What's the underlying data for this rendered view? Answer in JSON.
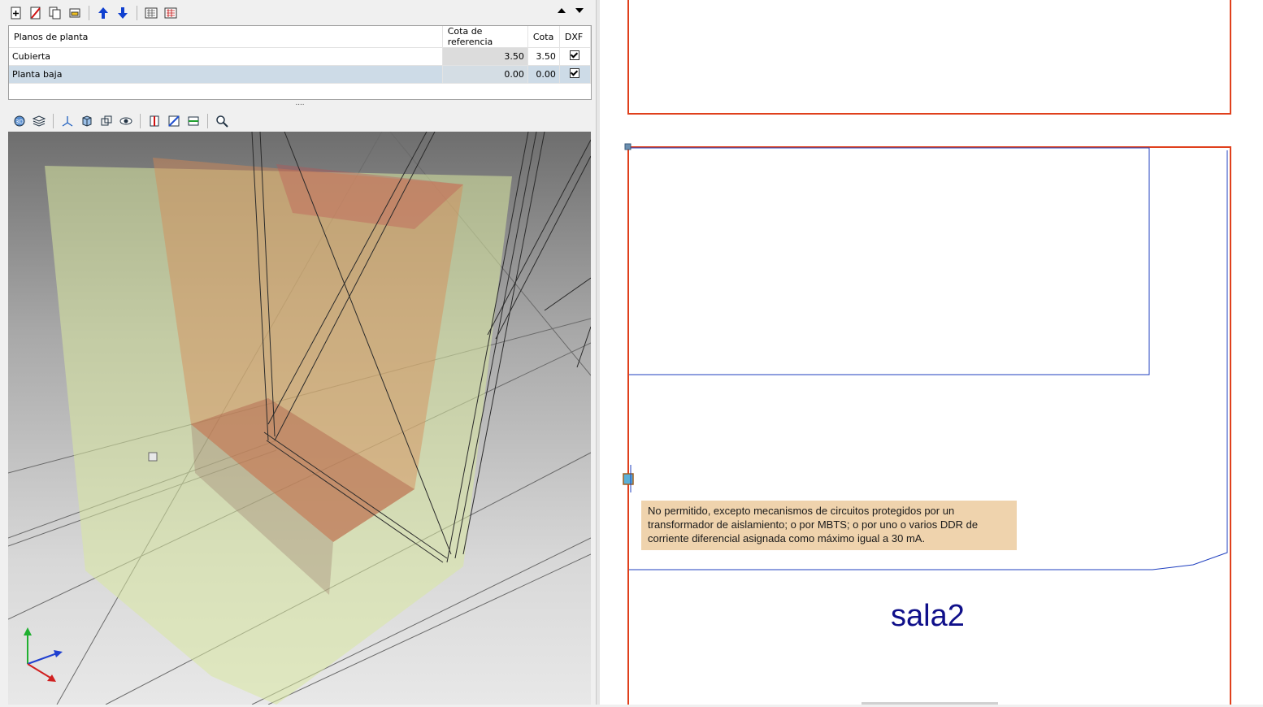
{
  "levels_table": {
    "headers": [
      "Planos de planta",
      "Cota de referencia",
      "Cota",
      "DXF"
    ],
    "rows": [
      {
        "name": "Cubierta",
        "ref": "3.50",
        "cota": "3.50",
        "dxf": true
      },
      {
        "name": "Planta baja",
        "ref": "0.00",
        "cota": "0.00",
        "dxf": true
      }
    ]
  },
  "splitter_grip": "....",
  "tooltip": "No permitido, excepto mecanismos de circuitos protegidos por un transformador de aislamiento; o por MBTS; o por uno o varios DDR de corriente diferencial asignada como máximo igual a 30 mA.",
  "room_label": "sala2",
  "toolbar_icons": [
    "new-level-icon",
    "delete-level-icon",
    "copy-level-icon",
    "edit-level-icon",
    "move-up-icon",
    "move-down-icon",
    "import-dxf-icon",
    "export-dxf-icon",
    "scroll-up-icon",
    "scroll-down-icon"
  ],
  "view_toolbar_icons": [
    "3d-view-icon",
    "layers-icon",
    "axes-icon",
    "solid-view-icon",
    "wireframe-view-icon",
    "visibility-icon",
    "section-red-icon",
    "section-blue-icon",
    "section-green-icon",
    "zoom-icon"
  ],
  "colors": {
    "wall_outline": "#e0401c",
    "room_outline": "#1f3fbf",
    "label": "#10108a",
    "tooltip_bg": "#efd3ad",
    "selected_row": "#cddbe7"
  }
}
